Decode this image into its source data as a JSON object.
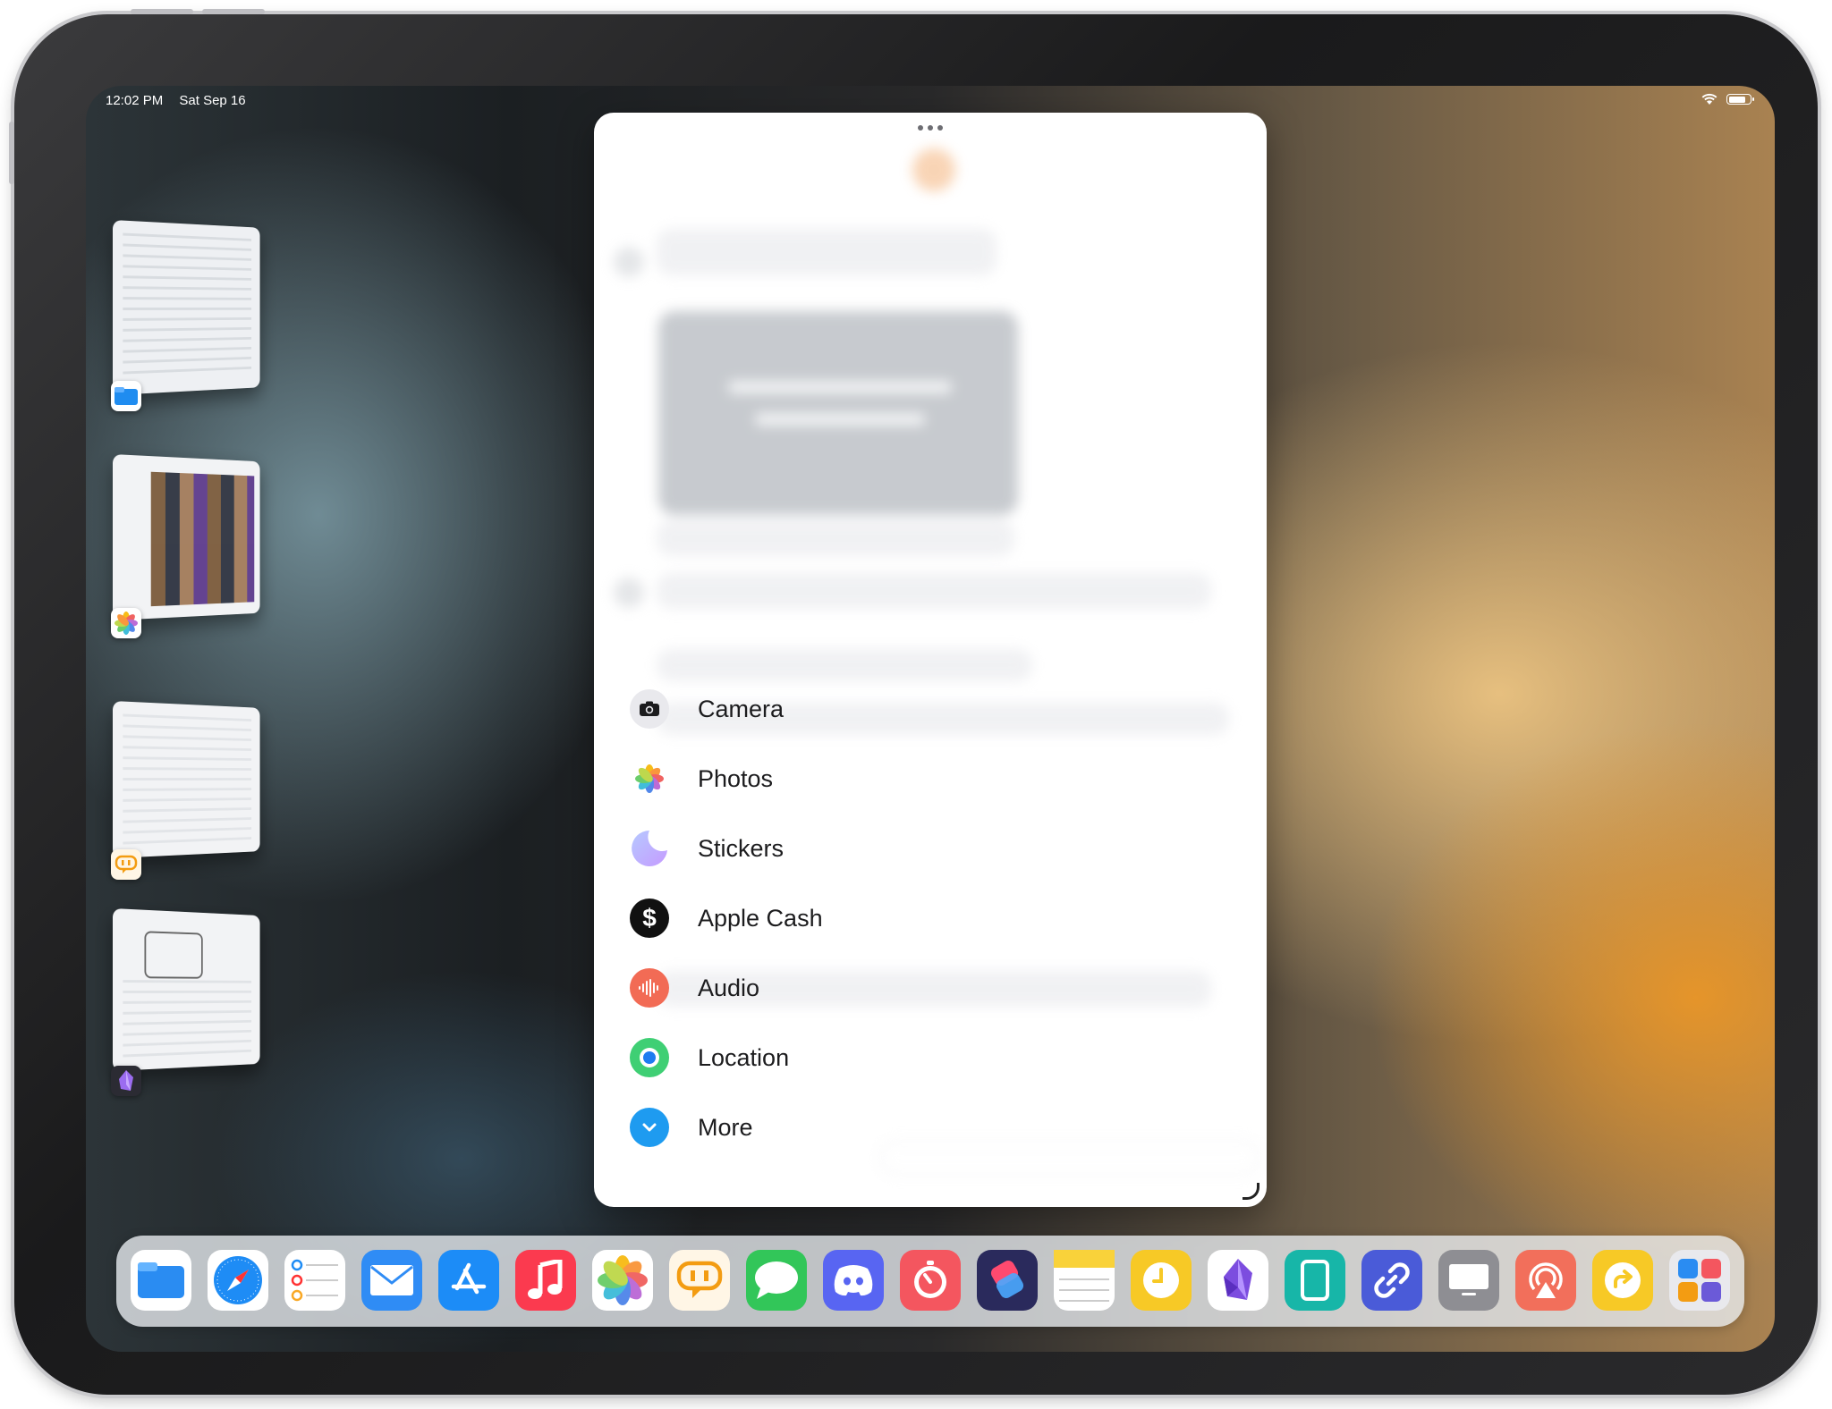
{
  "status_bar": {
    "time": "12:02 PM",
    "date": "Sat Sep 16"
  },
  "stage_manager": [
    {
      "app": "Files",
      "icon": "files-icon",
      "color": "#1f8cf0"
    },
    {
      "app": "Photos",
      "icon": "photos-icon",
      "color": "#ffffff"
    },
    {
      "app": "Mastodon client",
      "icon": "speech-bubble-icon",
      "color": "#f5a623"
    },
    {
      "app": "Obsidian",
      "icon": "obsidian-crystal-icon",
      "color": "#2b2b33"
    }
  ],
  "attachment_menu": {
    "items": [
      {
        "label": "Camera",
        "icon": "camera-icon",
        "color": "#e9e9ed"
      },
      {
        "label": "Photos",
        "icon": "photos-icon",
        "color": "#ffffff"
      },
      {
        "label": "Stickers",
        "icon": "stickers-icon",
        "color": "#e6e3ff"
      },
      {
        "label": "Apple Cash",
        "icon": "dollar-icon",
        "color": "#111111"
      },
      {
        "label": "Audio",
        "icon": "waveform-icon",
        "color": "#f26b55"
      },
      {
        "label": "Location",
        "icon": "location-icon",
        "color": "#3fcf74"
      },
      {
        "label": "More",
        "icon": "chevron-down-icon",
        "color": "#1e9bf0"
      }
    ]
  },
  "dock": [
    {
      "app": "Files",
      "icon": "files-icon",
      "color": "#2a8cf2"
    },
    {
      "app": "Safari",
      "icon": "safari-icon",
      "color": "#ffffff"
    },
    {
      "app": "Reminders",
      "icon": "reminders-icon",
      "color": "#ffffff"
    },
    {
      "app": "Mail",
      "icon": "mail-icon",
      "color": "#2f8cf5"
    },
    {
      "app": "App Store",
      "icon": "app-store-icon",
      "color": "#1c8cf7"
    },
    {
      "app": "Music",
      "icon": "music-icon",
      "color": "#fb3a4f"
    },
    {
      "app": "Photos",
      "icon": "photos-icon",
      "color": "#ffffff"
    },
    {
      "app": "Mastodon client",
      "icon": "speech-bubble-icon",
      "color": "#fff6e6"
    },
    {
      "app": "Messages",
      "icon": "messages-icon",
      "color": "#32c659"
    },
    {
      "app": "Discord",
      "icon": "discord-icon",
      "color": "#5865f2"
    },
    {
      "app": "Timer",
      "icon": "timer-icon",
      "color": "#f4565f"
    },
    {
      "app": "Shortcuts",
      "icon": "shortcuts-icon",
      "color": "#2a2a5c"
    },
    {
      "app": "Notes",
      "icon": "notes-icon",
      "color": "#ffffff"
    },
    {
      "app": "Clock",
      "icon": "clock-icon",
      "color": "#f7c926"
    },
    {
      "app": "Obsidian",
      "icon": "obsidian-crystal-icon",
      "color": "#ffffff"
    },
    {
      "app": "Sidecar",
      "icon": "tablet-icon",
      "color": "#17b6a8"
    },
    {
      "app": "Links",
      "icon": "link-icon",
      "color": "#4a5bd8"
    },
    {
      "app": "Display",
      "icon": "display-icon",
      "color": "#8e8e93"
    },
    {
      "app": "Podcast",
      "icon": "airplay-icon",
      "color": "#f26f5b"
    },
    {
      "app": "Arrow",
      "icon": "share-arrow-icon",
      "color": "#f7c926"
    },
    {
      "app": "App Library",
      "icon": "app-library-icon",
      "color": "#e9e9ed"
    }
  ]
}
